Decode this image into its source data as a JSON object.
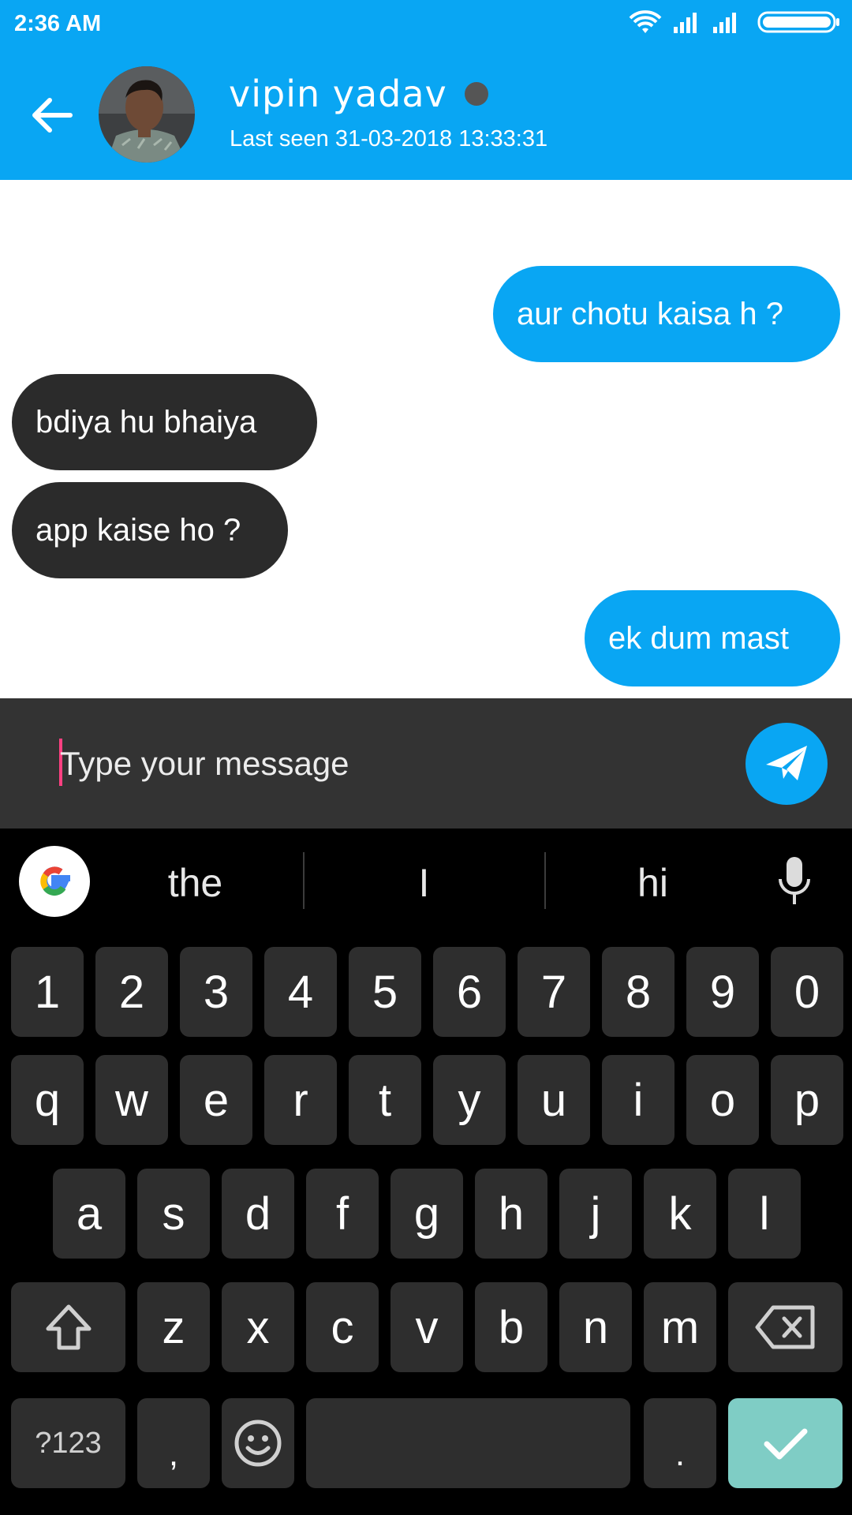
{
  "status_bar": {
    "time": "2:36 AM",
    "icons": [
      "wifi-icon",
      "signal-icon",
      "signal-icon",
      "battery-icon"
    ]
  },
  "app_bar": {
    "back_icon": "arrow-left-icon",
    "contact_name": "vipin yadav",
    "last_seen": "Last seen 31-03-2018 13:33:31",
    "presence_color": "#555555",
    "accent_color": "#09a6f3"
  },
  "messages": [
    {
      "direction": "outgoing",
      "text": "aur chotu kaisa h ?"
    },
    {
      "direction": "incoming",
      "text": "bdiya hu bhaiya"
    },
    {
      "direction": "incoming",
      "text": "app kaise ho ?"
    },
    {
      "direction": "outgoing",
      "text": "ek dum mast"
    }
  ],
  "composer": {
    "placeholder": "Type your message",
    "value": "",
    "send_icon": "paper-plane-icon"
  },
  "keyboard": {
    "suggestions": [
      "the",
      "I",
      "hi"
    ],
    "number_row": [
      "1",
      "2",
      "3",
      "4",
      "5",
      "6",
      "7",
      "8",
      "9",
      "0"
    ],
    "row1": [
      "q",
      "w",
      "e",
      "r",
      "t",
      "y",
      "u",
      "i",
      "o",
      "p"
    ],
    "row2": [
      "a",
      "s",
      "d",
      "f",
      "g",
      "h",
      "j",
      "k",
      "l"
    ],
    "row3": [
      "z",
      "x",
      "c",
      "v",
      "b",
      "n",
      "m"
    ],
    "symbols_label": "?123",
    "comma_label": ",",
    "period_label": ".",
    "enter_color": "#7fcdc5"
  }
}
